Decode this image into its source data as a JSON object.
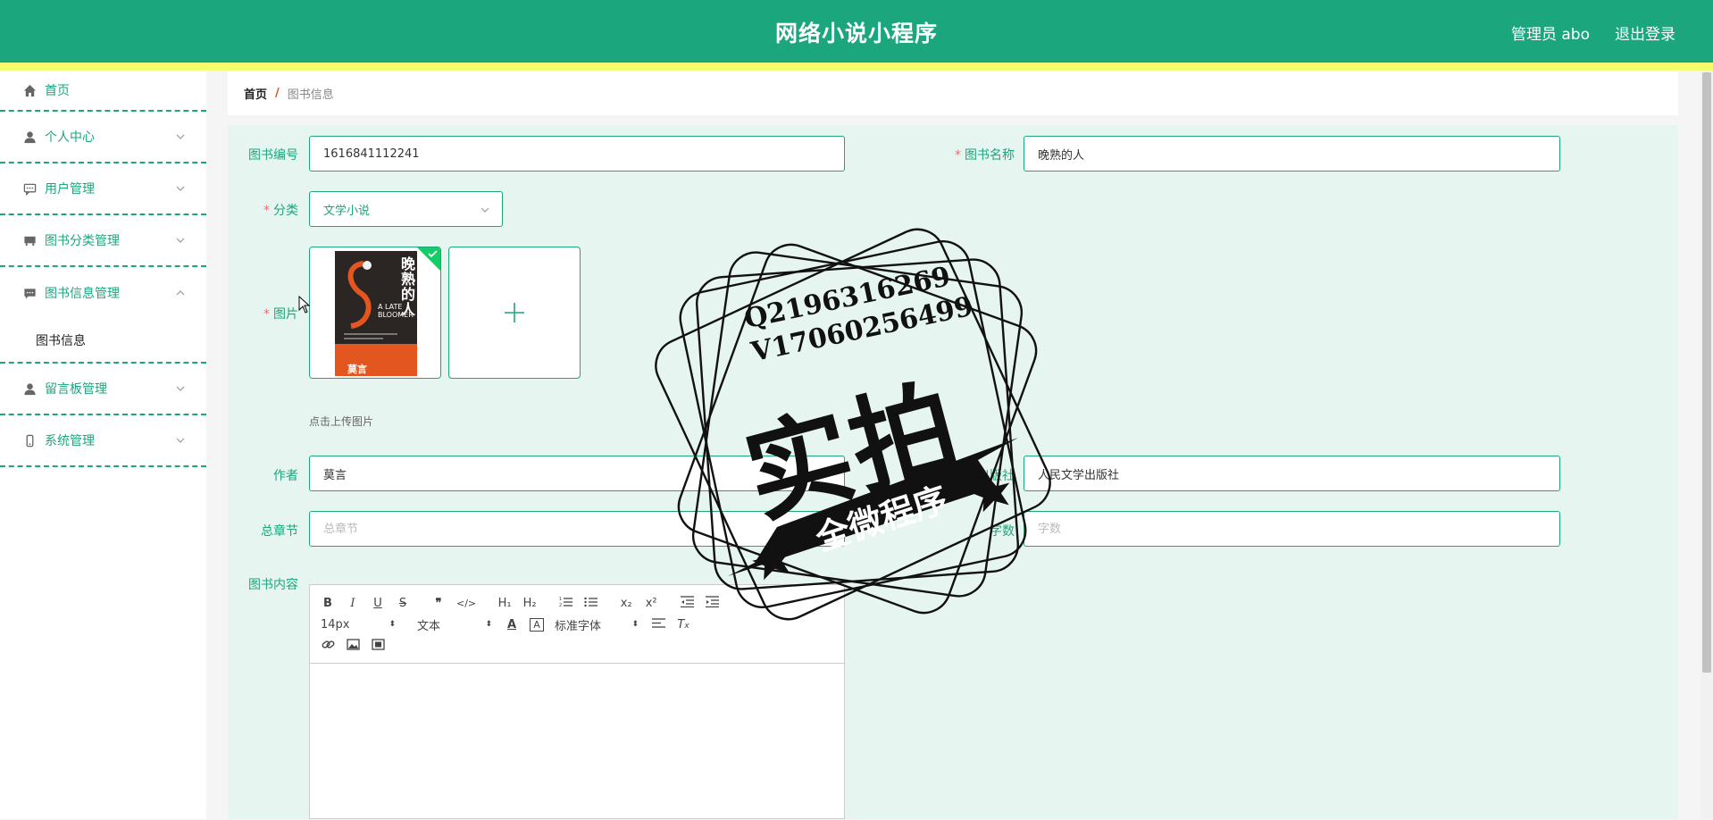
{
  "header": {
    "title": "网络小说小程序",
    "admin_label": "管理员 abo",
    "logout_label": "退出登录",
    "colors": {
      "primary": "#1ca67e",
      "stripe": "#f3fb6e"
    }
  },
  "sidebar": {
    "items": [
      {
        "label": "首页",
        "icon": "home-icon"
      },
      {
        "label": "个人中心",
        "icon": "user-icon"
      },
      {
        "label": "用户管理",
        "icon": "chat-icon"
      },
      {
        "label": "图书分类管理",
        "icon": "book-category-icon"
      },
      {
        "label": "图书信息管理",
        "icon": "message-icon",
        "open": true,
        "sub": [
          "图书信息"
        ]
      },
      {
        "label": "留言板管理",
        "icon": "user-icon"
      },
      {
        "label": "系统管理",
        "icon": "phone-icon"
      }
    ]
  },
  "breadcrumb": {
    "home": "首页",
    "separator": "/",
    "current": "图书信息"
  },
  "form": {
    "book_id": {
      "label": "图书编号",
      "value": "1616841112241"
    },
    "book_name": {
      "label": "图书名称",
      "value": "晚熟的人"
    },
    "category": {
      "label": "分类",
      "value": "文学小说"
    },
    "image": {
      "label": "图片",
      "hint": "点击上传图片",
      "cover": {
        "title": "晚熟的人",
        "en_title": "A LATE BLOOMER",
        "author": "莫言"
      }
    },
    "author": {
      "label": "作者",
      "value": "莫言"
    },
    "publisher": {
      "label": "出版社",
      "value": "人民文学出版社"
    },
    "chapters": {
      "label": "总章节",
      "placeholder": "总章节"
    },
    "words": {
      "label": "字数",
      "placeholder": "字数"
    },
    "content": {
      "label": "图书内容"
    }
  },
  "editor": {
    "font_size": "14px",
    "paragraph": "文本",
    "font_family": "标准字体",
    "buttons": {
      "bold": "B",
      "italic": "I",
      "underline": "U",
      "strike": "S",
      "h1": "H₁",
      "h2": "H₂",
      "sub": "x₂",
      "sup": "x²"
    }
  },
  "watermark": {
    "line1": "Q2196316269",
    "line2": "V17060256499",
    "big": "实拍",
    "banner": "全微程序"
  }
}
